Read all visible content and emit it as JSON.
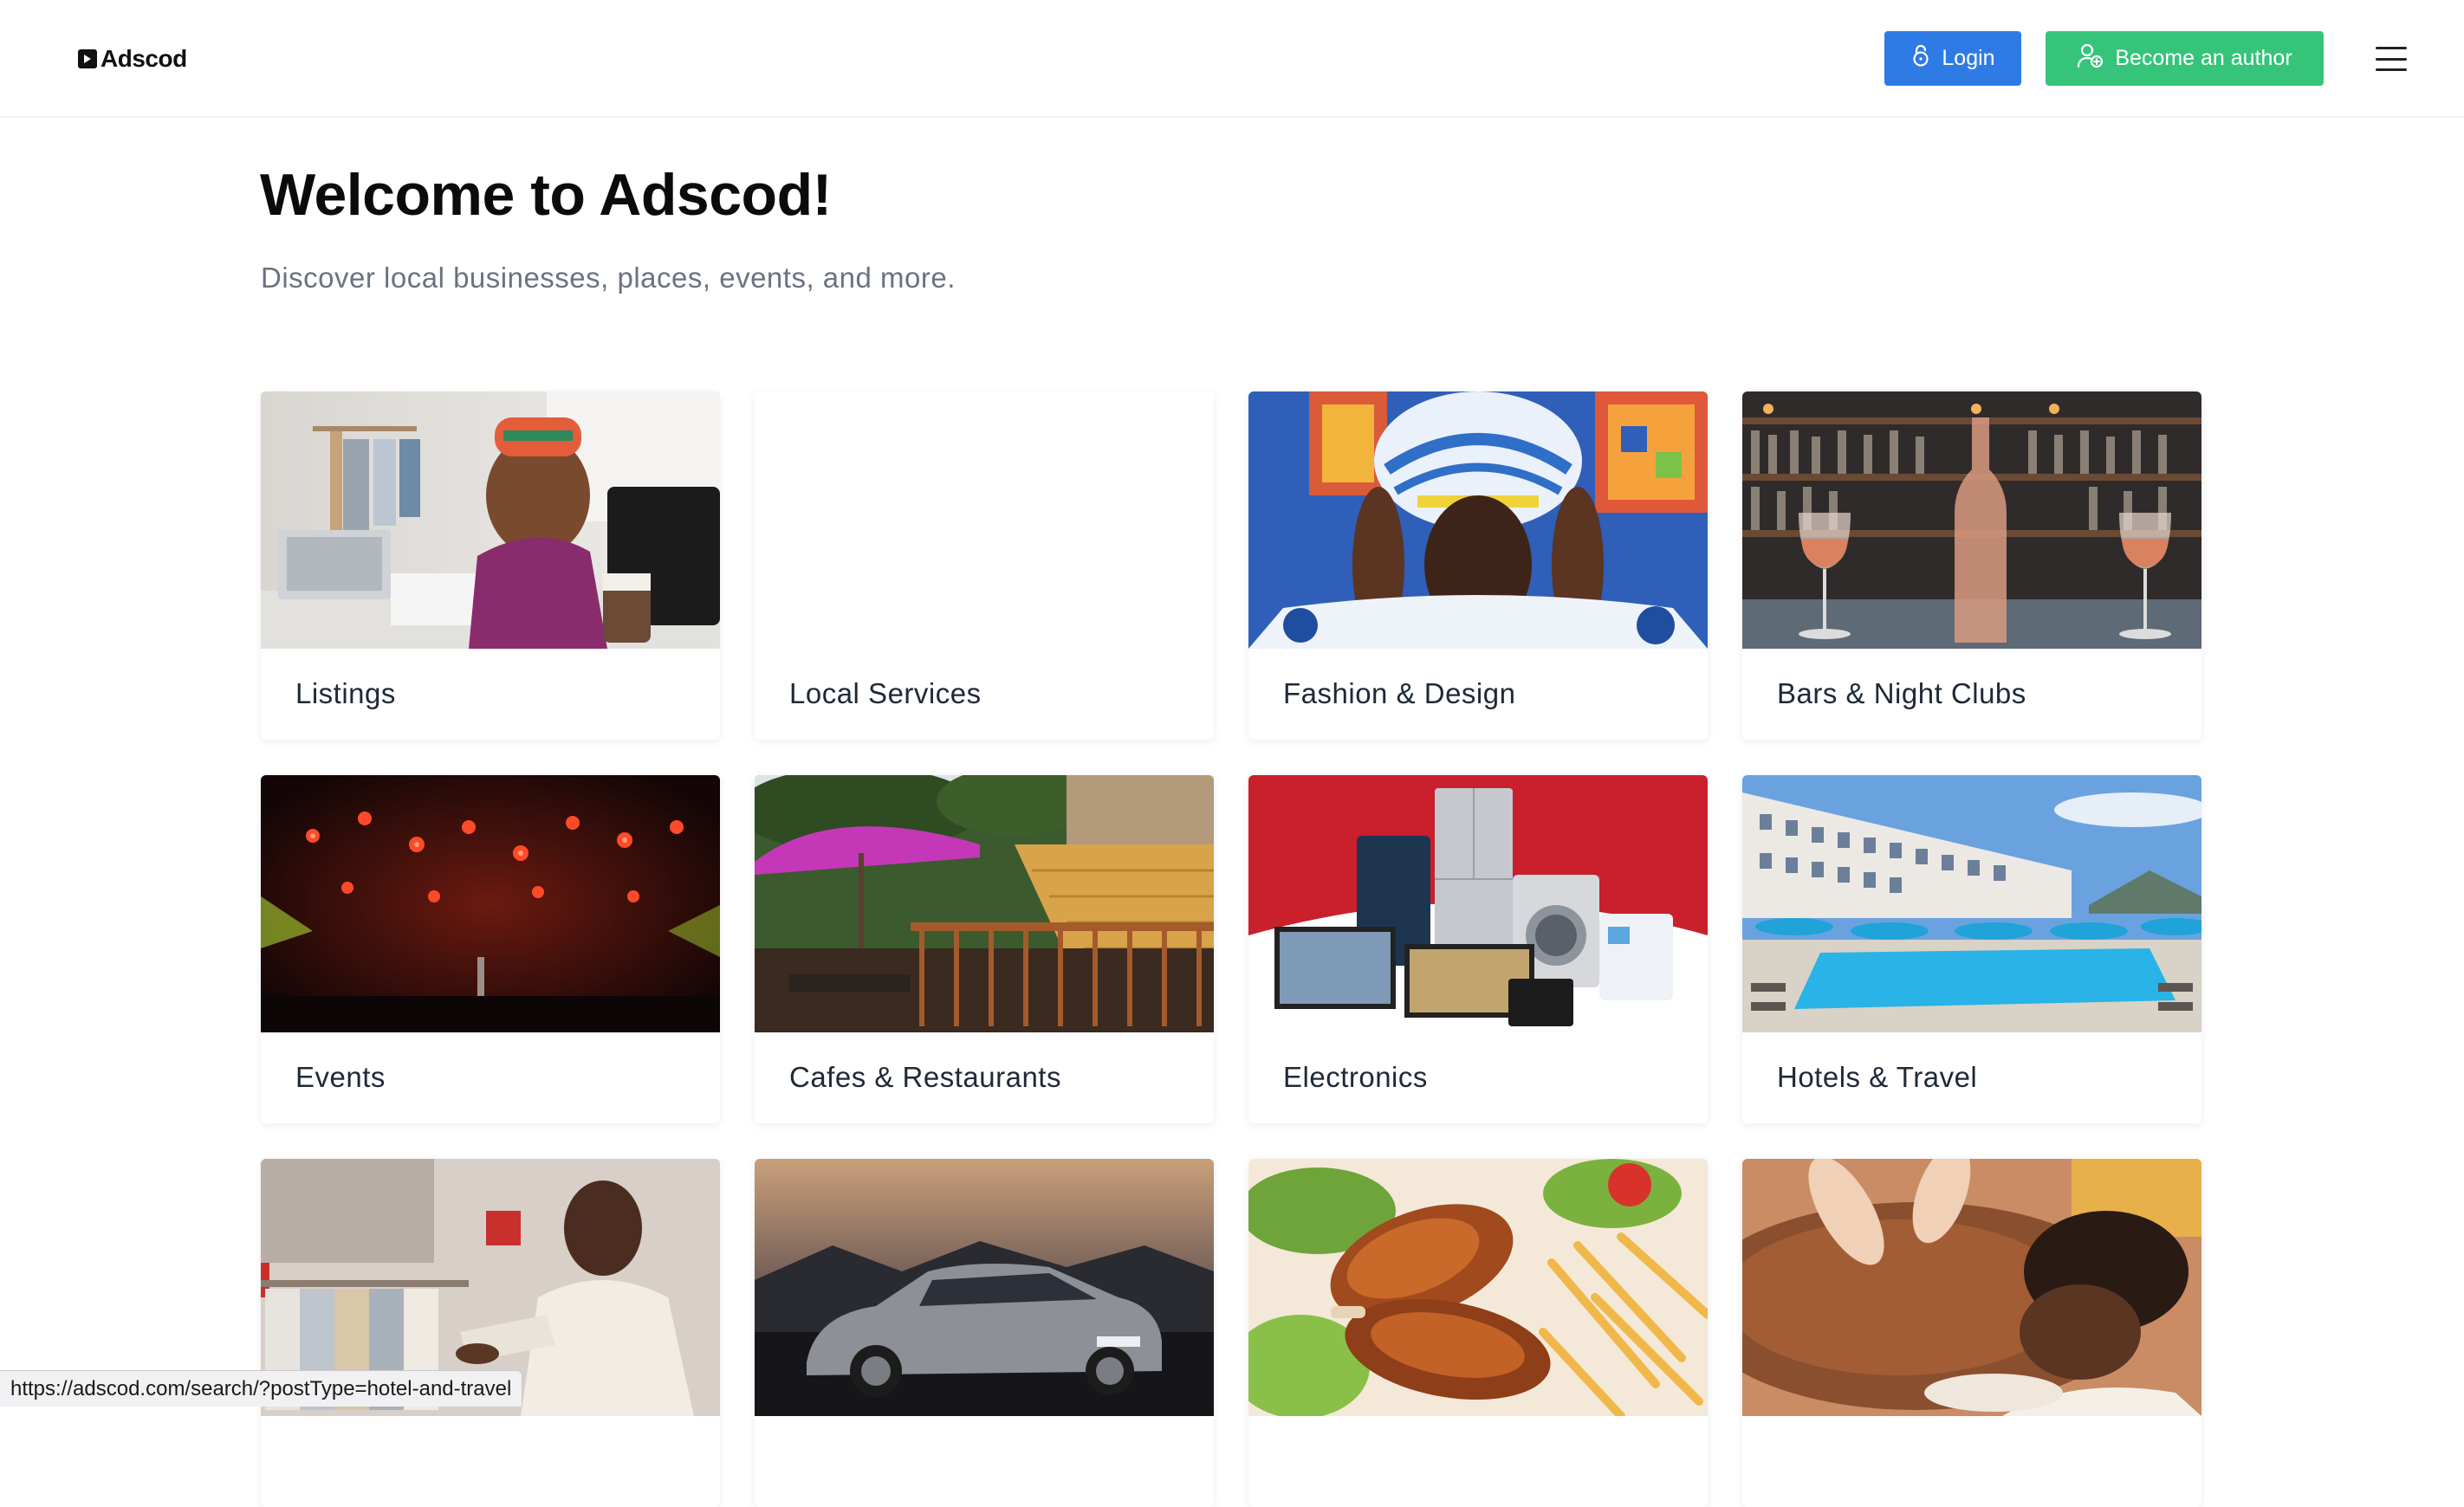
{
  "header": {
    "logo_text": "Adscod",
    "login_label": "Login",
    "author_label": "Become an author"
  },
  "hero": {
    "title": "Welcome to Adscod!",
    "subtitle": "Discover local businesses, places, events, and more."
  },
  "categories": [
    {
      "label": "Listings",
      "icon": "office-woman-phone-image"
    },
    {
      "label": "Local Services",
      "icon": "blank-image"
    },
    {
      "label": "Fashion & Design",
      "icon": "headwrap-portrait-image"
    },
    {
      "label": "Bars & Night Clubs",
      "icon": "wine-bar-image"
    },
    {
      "label": "Events",
      "icon": "concert-stage-image"
    },
    {
      "label": "Cafes & Restaurants",
      "icon": "outdoor-cafe-image"
    },
    {
      "label": "Electronics",
      "icon": "appliances-image"
    },
    {
      "label": "Hotels & Travel",
      "icon": "hotel-pool-image"
    },
    {
      "label": "",
      "icon": "clothing-shopping-image"
    },
    {
      "label": "",
      "icon": "sedan-car-image"
    },
    {
      "label": "",
      "icon": "grilled-chicken-image"
    },
    {
      "label": "",
      "icon": "massage-spa-image"
    }
  ],
  "status_bar": {
    "url": "https://adscod.com/search/?postType=hotel-and-travel"
  },
  "colors": {
    "login_button": "#2f7be5",
    "author_button": "#36c47b",
    "subtitle_text": "#6b7280"
  }
}
